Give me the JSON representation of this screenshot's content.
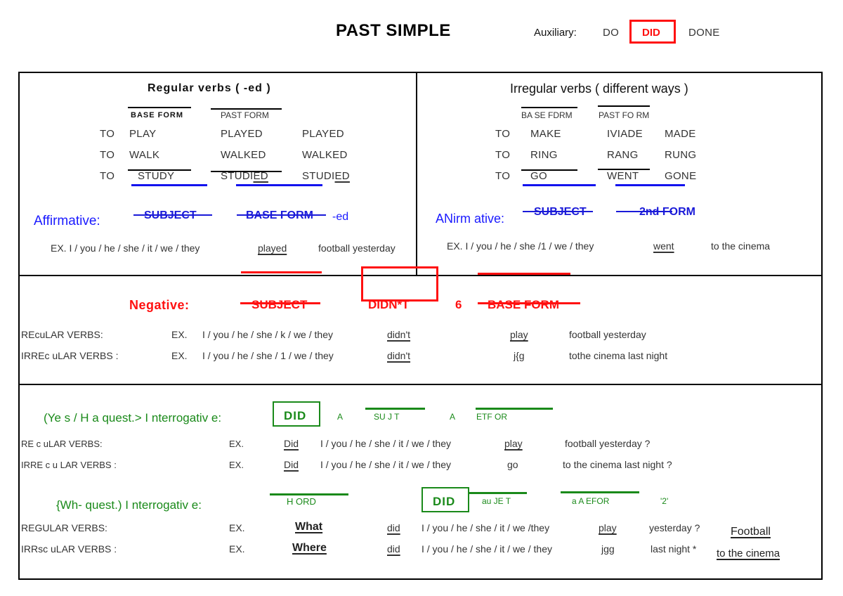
{
  "header": {
    "title": "PAST SIMPLE",
    "auxiliary_label": "Auxiliary:",
    "auxiliary_forms": [
      "DO",
      "DID",
      "DONE"
    ],
    "highlighted_form": "DID"
  },
  "regular": {
    "heading": "Regular verbs ( -ed )",
    "col_base": "BASE FORM",
    "col_past": "PAST FORM",
    "rows": [
      {
        "to": "TO",
        "base": "PLAY",
        "past": "PLAYED",
        "participle": "PLAYED"
      },
      {
        "to": "TO",
        "base": "WALK",
        "past": "WALKED",
        "participle": "WALKED"
      },
      {
        "to": "TO",
        "base": "STUDY",
        "past_stem": "STUDI",
        "past_suffix": "ED",
        "part_stem": "STUDI",
        "part_suffix": "ED"
      }
    ],
    "affirmative": {
      "label": "Affirmative:",
      "subject": "SUBJECT",
      "form": "BASE FORM",
      "suffix": "-ed",
      "example_prefix": "EX.  I / you / he / she / it / we / they",
      "example_verb": "played",
      "example_rest": "football yesterday"
    }
  },
  "irregular": {
    "heading": "Irregular verbs ( different ways )",
    "col_base": "BA SE FDRM",
    "col_past": "PAST FO RM",
    "rows": [
      {
        "to": "TO",
        "base": "MAKE",
        "past": "IVIADE",
        "participle": "MADE"
      },
      {
        "to": "TO",
        "base": "RING",
        "past": "RANG",
        "participle": "RUNG"
      },
      {
        "to": "TO",
        "base": "GO",
        "past": "WENT",
        "participle": "GONE"
      }
    ],
    "affirmative": {
      "label": "ANirm ative:",
      "subject": "SUBJECT",
      "form": "2nd FORM",
      "example_prefix": "EX. I / you / he / she /1 / we / they",
      "example_verb": "went",
      "example_rest": "to the cinema"
    }
  },
  "negative": {
    "label": "Negative:",
    "subject": "SUBJECT",
    "aux": "DIDN*T",
    "connector": "6",
    "form": "BASE FORM",
    "rows": [
      {
        "label": "REcuLAR VERBS:",
        "ex": "EX.",
        "subjects": "I / you / he / she / k / we / they",
        "aux": "didn't",
        "verb": "play",
        "rest": "football yesterday"
      },
      {
        "label": "IRREc uLAR VERBS :",
        "ex": "EX.",
        "subjects": "I / you / he / she / 1 / we / they",
        "aux": "didn't",
        "verb": "j{g",
        "rest": "tothe cinema last night"
      }
    ]
  },
  "yesno": {
    "label": "(Ye s / H a quest.>  I nterrogativ e:",
    "aux": "DID",
    "plus1": "A",
    "subject": "SU  J     T",
    "plus2": "A",
    "form": "ETF          OR",
    "rows": [
      {
        "label": "RE c uLAR  VERBS:",
        "ex": "EX.",
        "aux": "Did",
        "subjects": "I / you / he / she / it / we / they",
        "verb": "play",
        "rest": "football yesterday ?"
      },
      {
        "label": "IRRE c  u LAR  VERBS :",
        "ex": "EX.",
        "aux": "Did",
        "subjects": "I / you / he / she / it / we / they",
        "verb": "go",
        "rest": "to the cinema last night ?"
      }
    ]
  },
  "wh": {
    "label": "{Wh- quest.)  I   nterrogativ  e:",
    "wh_word": "H      ORD",
    "aux": "DID",
    "subject": "au    JE    T",
    "plus": "a    A   EFOR",
    "tail": "'2'",
    "rows": [
      {
        "label": "REGULAR VERBS:",
        "ex": "EX.",
        "wh": "What",
        "aux": "did",
        "subjects": "I / you / he / she / it / we /they",
        "verb": "play",
        "rest": "yesterday ?",
        "answer": "Football"
      },
      {
        "label": "IRRsc uLAR VERBS :",
        "ex": "EX.",
        "wh": "Where",
        "aux": "did",
        "subjects": "I / you / he / she / it / we / they",
        "verb": "jgg",
        "rest": "last night *",
        "answer": "to the  cinema"
      }
    ]
  }
}
